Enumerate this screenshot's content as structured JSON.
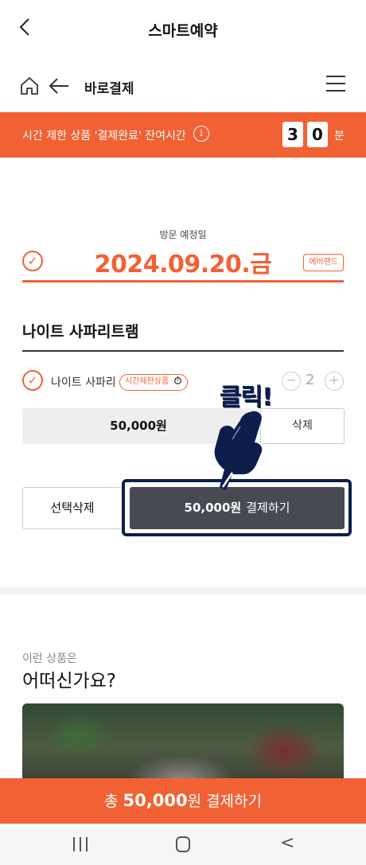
{
  "header": {
    "back_icon": "chevron-left-icon",
    "title": "스마트예약"
  },
  "subnav": {
    "home_icon": "home-icon",
    "arrow_icon": "arrow-left-icon",
    "label": "바로결제",
    "menu_icon": "hamburger-menu-icon"
  },
  "timer": {
    "text": "시간 제한 상품 '결제완료' 잔여시간",
    "info_icon": "info-icon",
    "info_glyph": "i",
    "digit1": "3",
    "digit2": "0",
    "unit": "분",
    "color": "#f26134"
  },
  "visit": {
    "label": "방문 예정일",
    "date": "2024.09.20.금",
    "tag": "에버랜드",
    "check_glyph": "✓"
  },
  "product": {
    "title": "나이트 사파리트램",
    "item": {
      "name": "나이트 사파리",
      "limit_tag": "시간제한상품",
      "timer_icon": "stopwatch-icon",
      "minus": "−",
      "quantity": "2",
      "plus": "+"
    },
    "price": "50,000원",
    "delete_label": "삭제"
  },
  "actions": {
    "select_delete": "선택삭제",
    "pay_price": "50,000원",
    "pay_label": "결제하기"
  },
  "annotation": {
    "text": "클릭!",
    "color": "#0d1e4d"
  },
  "recommend": {
    "subtitle": "이런 상품은",
    "title": "어떠신가요?"
  },
  "bottom_pay": {
    "prefix": "총",
    "amount": "50,000",
    "suffix": "원 결제하기"
  },
  "system_nav": {
    "recent_icon": "recent-apps-icon",
    "home_icon": "home-button-icon",
    "back_glyph": "<"
  }
}
